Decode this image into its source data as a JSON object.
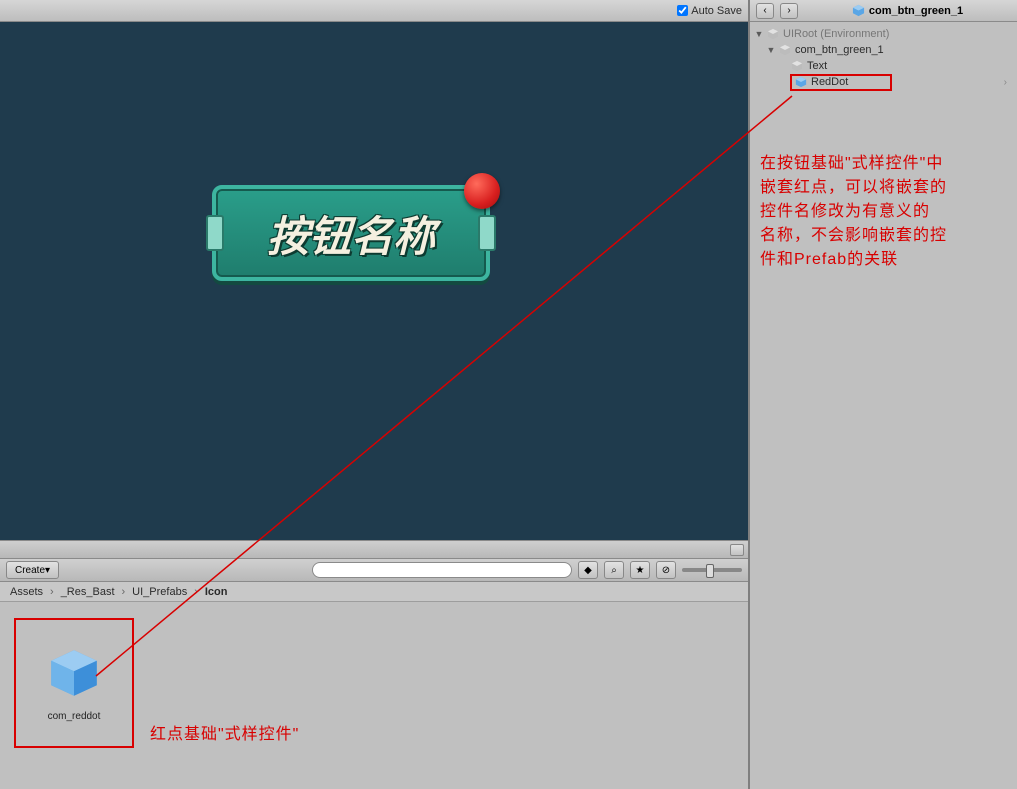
{
  "toolbar": {
    "auto_save_label": "Auto Save",
    "auto_save_checked": true,
    "create_label": "Create",
    "nav_back": "‹",
    "nav_fwd": "›"
  },
  "scene": {
    "button_text": "按钮名称"
  },
  "breadcrumb": {
    "items": [
      "Assets",
      "_Res_Bast",
      "UI_Prefabs",
      "Icon"
    ]
  },
  "project": {
    "asset_name": "com_reddot"
  },
  "annotations": {
    "bottom": "红点基础\"式样控件\"",
    "right_l1": "在按钮基础\"式样控件\"中",
    "right_l2": "嵌套红点，可以将嵌套的",
    "right_l3": "控件名修改为有意义的",
    "right_l4": "名称，不会影响嵌套的控",
    "right_l5": "件和Prefab的关联"
  },
  "right_header": {
    "title": "com_btn_green_1"
  },
  "hierarchy": {
    "root": "UIRoot (Environment)",
    "child1": "com_btn_green_1",
    "child2": "Text",
    "child3": "RedDot"
  }
}
